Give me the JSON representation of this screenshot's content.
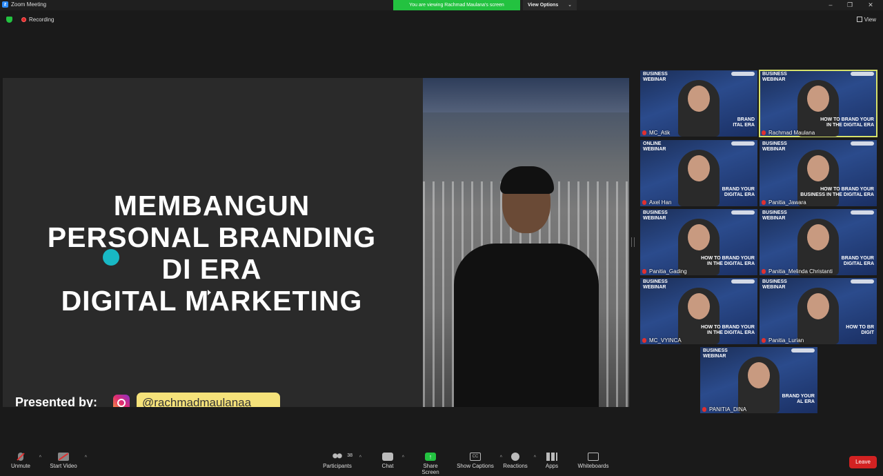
{
  "window": {
    "title": "Zoom Meeting",
    "banner": "You are viewing Rachmad Maulana's screen",
    "view_options": "View Options",
    "controls": [
      "–",
      "❐",
      "✕"
    ]
  },
  "status": {
    "recording": "Recording",
    "view": "View"
  },
  "slide": {
    "title_lines": [
      "MEMBANGUN",
      "PERSONAL BRANDING",
      "DI ERA",
      "DIGITAL MARKETING"
    ],
    "presented_by": "Presented by:",
    "handle": "@rachmadmaulanaa_"
  },
  "participants": [
    {
      "name": "MC_Atik",
      "brand": "BUSINESS\nWEBINAR",
      "tagline": "BRAND\nITAL ERA",
      "active": false
    },
    {
      "name": "Rachmad Maulana",
      "brand": "BUSINESS\nWEBINAR",
      "tagline": "HOW TO BRAND YOUR\nIN THE DIGITAL ERA",
      "active": true
    },
    {
      "name": "Axel Han",
      "brand": "ONLINE\nWEBINAR",
      "tagline": "BRAND YOUR\nDIGITAL ERA",
      "active": false
    },
    {
      "name": "Panitia_Jawara",
      "brand": "BUSINESS\nWEBINAR",
      "tagline": "HOW TO BRAND YOUR\nBUSINESS IN THE DIGITAL ERA",
      "active": false
    },
    {
      "name": "Panitia_Gading",
      "brand": "BUSINESS\nWEBINAR",
      "tagline": "HOW TO BRAND YOUR\nIN THE DIGITAL ERA",
      "active": false
    },
    {
      "name": "Panitia_Melinda Christanti",
      "brand": "BUSINESS\nWEBINAR",
      "tagline": "BRAND YOUR\nDIGITAL ERA",
      "active": false
    },
    {
      "name": "MC_VYINCA",
      "brand": "BUSINESS\nWEBINAR",
      "tagline": "HOW TO BRAND YOUR\nIN THE DIGITAL ERA",
      "active": false
    },
    {
      "name": "Panitia_Lurian",
      "brand": "BUSINESS\nWEBINAR",
      "tagline": "HOW TO BR\nDIGIT",
      "active": false
    },
    {
      "name": "PANITIA_DINA",
      "brand": "BUSINESS\nWEBINAR",
      "tagline": "BRAND YOUR\nAL ERA",
      "active": false
    }
  ],
  "toolbar": {
    "unmute": "Unmute",
    "start_video": "Start Video",
    "participants": "Participants",
    "participant_count": "38",
    "chat": "Chat",
    "share_screen": "Share Screen",
    "show_captions": "Show Captions",
    "reactions": "Reactions",
    "apps": "Apps",
    "whiteboards": "Whiteboards",
    "leave": "Leave"
  },
  "colors": {
    "accent_green": "#23c240",
    "leave_red": "#d32222",
    "active_speaker": "#d8e26a",
    "slide_dot": "#18b8c4",
    "handle_pill": "#f5e27a"
  }
}
